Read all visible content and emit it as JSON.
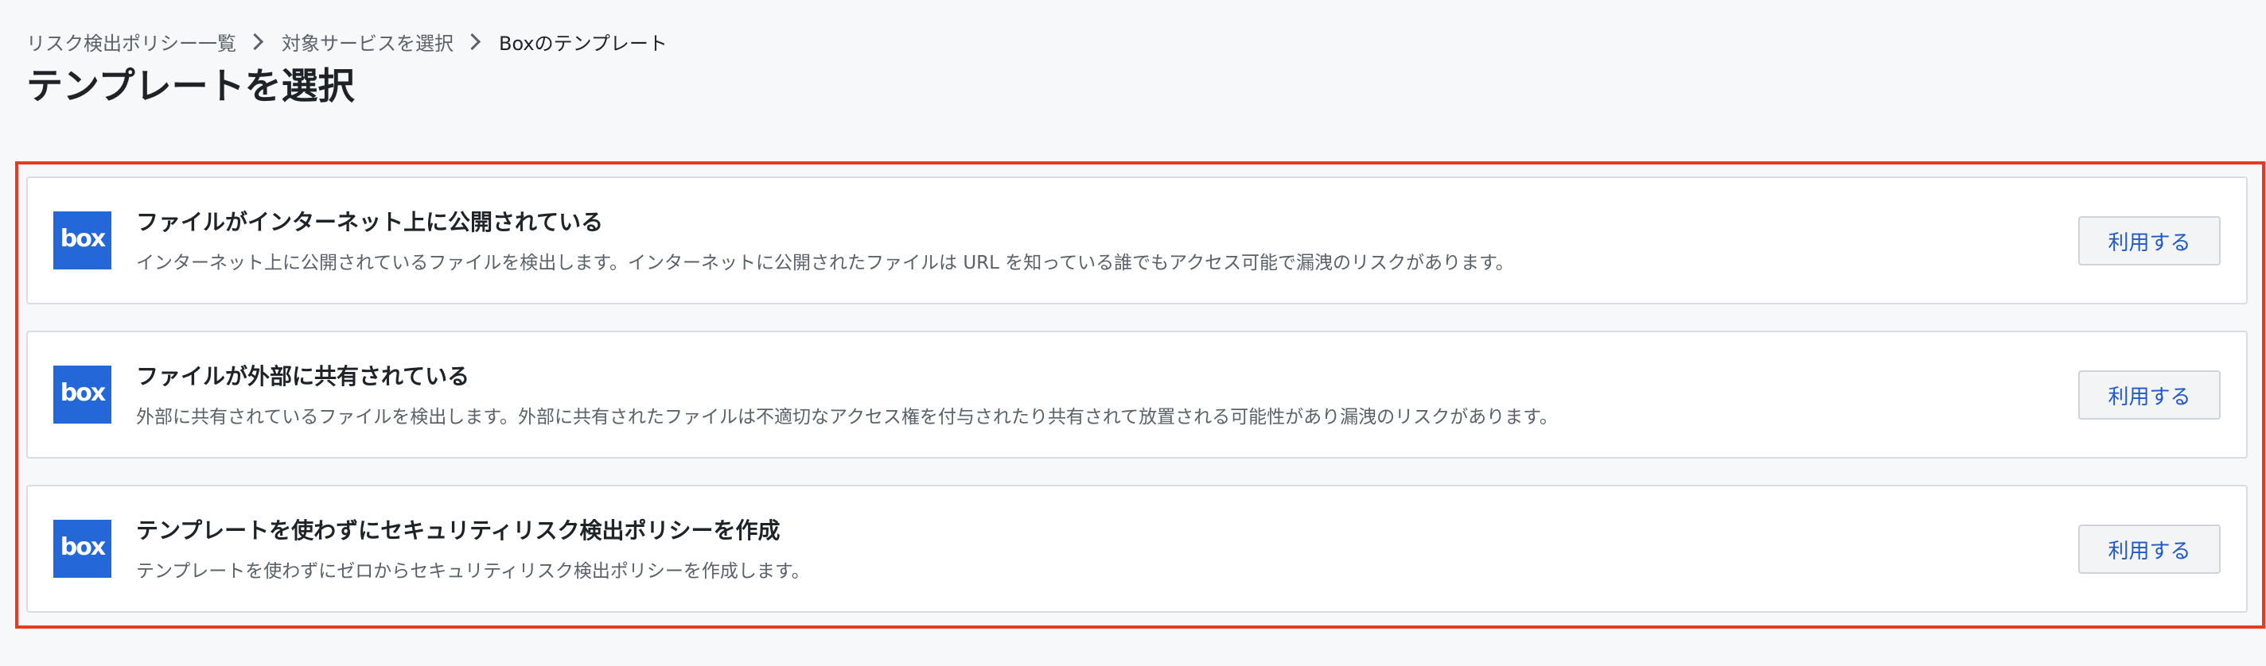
{
  "breadcrumb": {
    "items": [
      "リスク検出ポリシー一覧",
      "対象サービスを選択"
    ],
    "current": "Boxのテンプレート"
  },
  "page": {
    "title": "テンプレートを選択"
  },
  "brand": {
    "logo_text": "box",
    "logo_color": "#2467d9",
    "highlight_color": "#e23c26"
  },
  "templates": [
    {
      "title": "ファイルがインターネット上に公開されている",
      "description": "インターネット上に公開されているファイルを検出します。インターネットに公開されたファイルは URL を知っている誰でもアクセス可能で漏洩のリスクがあります。",
      "button_label": "利用する"
    },
    {
      "title": "ファイルが外部に共有されている",
      "description": "外部に共有されているファイルを検出します。外部に共有されたファイルは不適切なアクセス権を付与されたり共有されて放置される可能性があり漏洩のリスクがあります。",
      "button_label": "利用する"
    },
    {
      "title": "テンプレートを使わずにセキュリティリスク検出ポリシーを作成",
      "description": "テンプレートを使わずにゼロからセキュリティリスク検出ポリシーを作成します。",
      "button_label": "利用する"
    }
  ]
}
